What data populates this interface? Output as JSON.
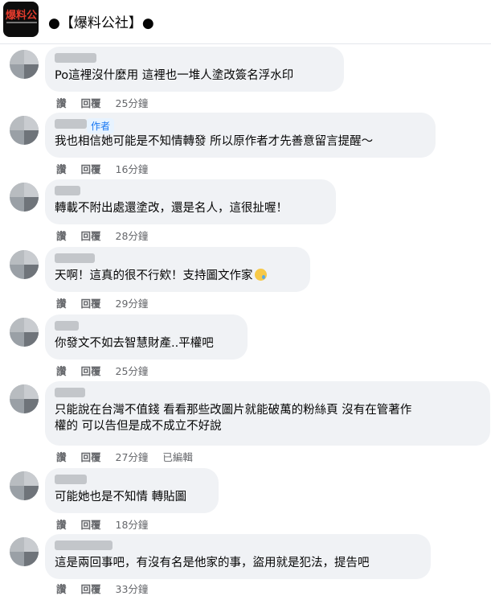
{
  "header": {
    "page_name": "●【爆料公社】●",
    "logo_text": "爆料公"
  },
  "comments": [
    {
      "text": "Po這裡沒什麼用 這裡也一堆人塗改簽名浮水印",
      "like": "讚",
      "reply": "回覆",
      "time": "25分鐘"
    },
    {
      "badge": "作者",
      "text": "我也相信她可能是不知情轉發 所以原作者才先善意留言提醒～",
      "like": "讚",
      "reply": "回覆",
      "time": "16分鐘"
    },
    {
      "text": "轉載不附出處還塗改，還是名人，這很扯喔！",
      "like": "讚",
      "reply": "回覆",
      "time": "28分鐘"
    },
    {
      "text": "天啊！這真的很不行欸！支持圖文作家",
      "emoji": "sad-tear-emoji",
      "like": "讚",
      "reply": "回覆",
      "time": "29分鐘"
    },
    {
      "text": "你發文不如去智慧財產..平權吧",
      "like": "讚",
      "reply": "回覆",
      "time": "25分鐘"
    },
    {
      "text_line1": "只能說在台灣不值錢 看看那些改圖片就能破萬的粉絲頁 沒有在管著作",
      "text_line2": "權的 可以告但是成不成立不好說",
      "like": "讚",
      "reply": "回覆",
      "time": "27分鐘",
      "edited": "已編輯"
    },
    {
      "text": "可能她也是不知情 轉貼圖",
      "like": "讚",
      "reply": "回覆",
      "time": "18分鐘"
    },
    {
      "text": "這是兩回事吧，有沒有名是他家的事，盜用就是犯法，提告吧",
      "like": "讚",
      "reply": "回覆",
      "time": "33分鐘"
    }
  ]
}
